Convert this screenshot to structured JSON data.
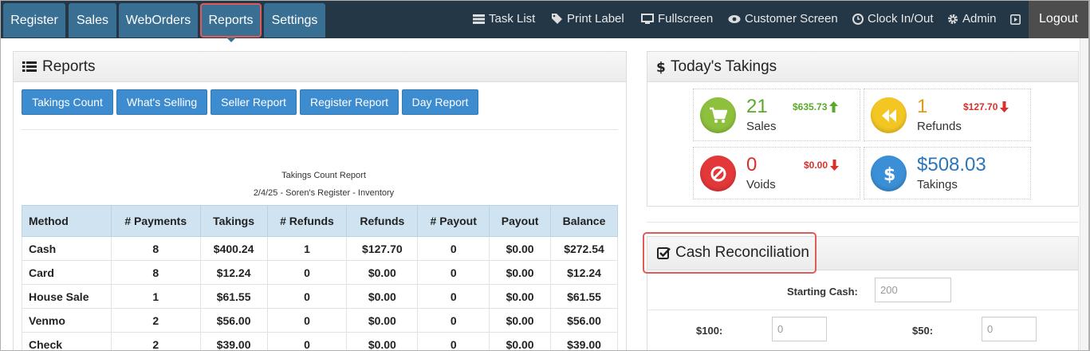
{
  "nav": {
    "tabs": [
      "Register",
      "Sales",
      "WebOrders",
      "Reports",
      "Settings"
    ],
    "links": {
      "task_list": "Task List",
      "print_label": "Print Label",
      "fullscreen": "Fullscreen",
      "customer_screen": "Customer Screen",
      "clock": "Clock In/Out",
      "admin": "Admin"
    },
    "logout": "Logout"
  },
  "reports": {
    "title": "Reports",
    "buttons": [
      "Takings Count",
      "What's Selling",
      "Seller Report",
      "Register Report",
      "Day Report"
    ],
    "report_title": "Takings Count Report",
    "report_subtitle": "2/4/25 - Soren's Register - Inventory",
    "columns": [
      "Method",
      "# Payments",
      "Takings",
      "# Refunds",
      "Refunds",
      "# Payout",
      "Payout",
      "Balance"
    ],
    "rows": [
      [
        "Cash",
        "8",
        "$400.24",
        "1",
        "$127.70",
        "0",
        "$0.00",
        "$272.54"
      ],
      [
        "Card",
        "8",
        "$12.24",
        "0",
        "$0.00",
        "0",
        "$0.00",
        "$12.24"
      ],
      [
        "House Sale",
        "1",
        "$61.55",
        "0",
        "$0.00",
        "0",
        "$0.00",
        "$61.55"
      ],
      [
        "Venmo",
        "2",
        "$56.00",
        "0",
        "$0.00",
        "0",
        "$0.00",
        "$56.00"
      ],
      [
        "Check",
        "2",
        "$39.00",
        "0",
        "$0.00",
        "0",
        "$0.00",
        "$39.00"
      ]
    ]
  },
  "takings": {
    "title": "Today's Takings",
    "sales": {
      "count": "21",
      "label": "Sales",
      "amount": "$635.73"
    },
    "refunds": {
      "count": "1",
      "label": "Refunds",
      "amount": "$127.70"
    },
    "voids": {
      "count": "0",
      "label": "Voids",
      "amount": "$0.00"
    },
    "total": {
      "amount": "$508.03",
      "label": "Takings"
    }
  },
  "recon": {
    "title": "Cash Reconciliation",
    "starting_cash_label": "Starting Cash:",
    "starting_cash_value": "200",
    "label_100": "$100:",
    "value_100": "0",
    "label_50": "$50:",
    "value_50": "0"
  },
  "colors": {
    "nav_bg": "#243746",
    "tab_bg": "#3a6f94",
    "button_blue": "#3d8ccf",
    "highlight_red": "#e05a5a",
    "green": "#5aaa2a",
    "red": "#d9302b",
    "orange": "#e09a1a",
    "blue": "#2a76b8"
  }
}
